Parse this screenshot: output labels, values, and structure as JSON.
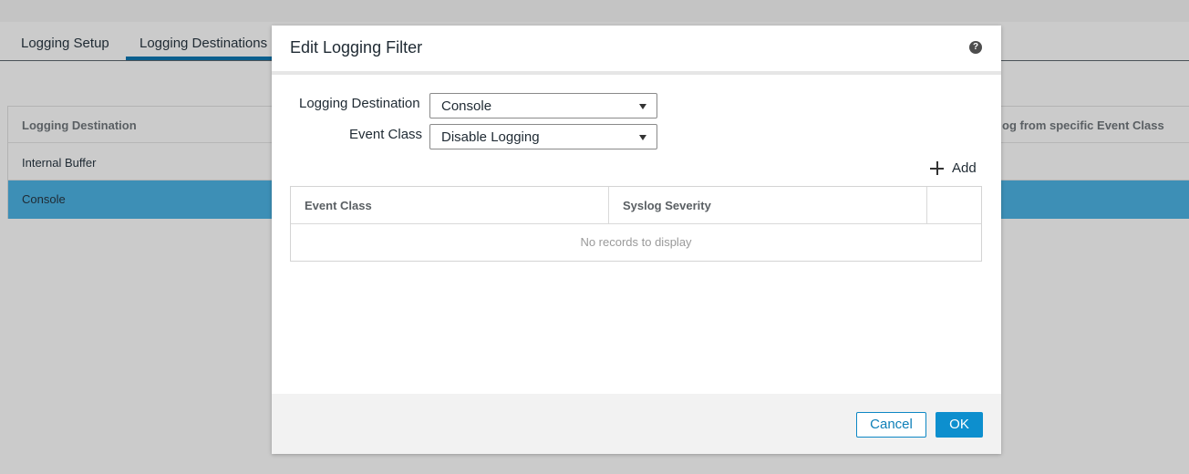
{
  "background": {
    "tabs": [
      {
        "label": "Logging Setup",
        "active": false
      },
      {
        "label": "Logging Destinations",
        "active": true
      }
    ],
    "table": {
      "headers": [
        "Logging Destination",
        "og from specific Event Class"
      ],
      "rows": [
        "Internal Buffer",
        "Console"
      ],
      "selected_row": "Console"
    }
  },
  "modal": {
    "title": "Edit Logging Filter",
    "help_glyph": "?",
    "form": {
      "logging_destination_label": "Logging Destination",
      "logging_destination_value": "Console",
      "event_class_label": "Event Class",
      "event_class_value": "Disable Logging"
    },
    "add_label": "Add",
    "table": {
      "headers": [
        "Event Class",
        "Syslog Severity",
        ""
      ],
      "empty_message": "No records to display"
    },
    "footer": {
      "cancel_label": "Cancel",
      "ok_label": "OK"
    }
  },
  "colors": {
    "accent": "#0d8fce",
    "selected_row": "#3d8fb6",
    "active_tab_bar": "#0a5f8e"
  },
  "icons": {
    "help": "help-icon",
    "add": "plus-icon",
    "dropdown": "chevron-down-icon"
  }
}
